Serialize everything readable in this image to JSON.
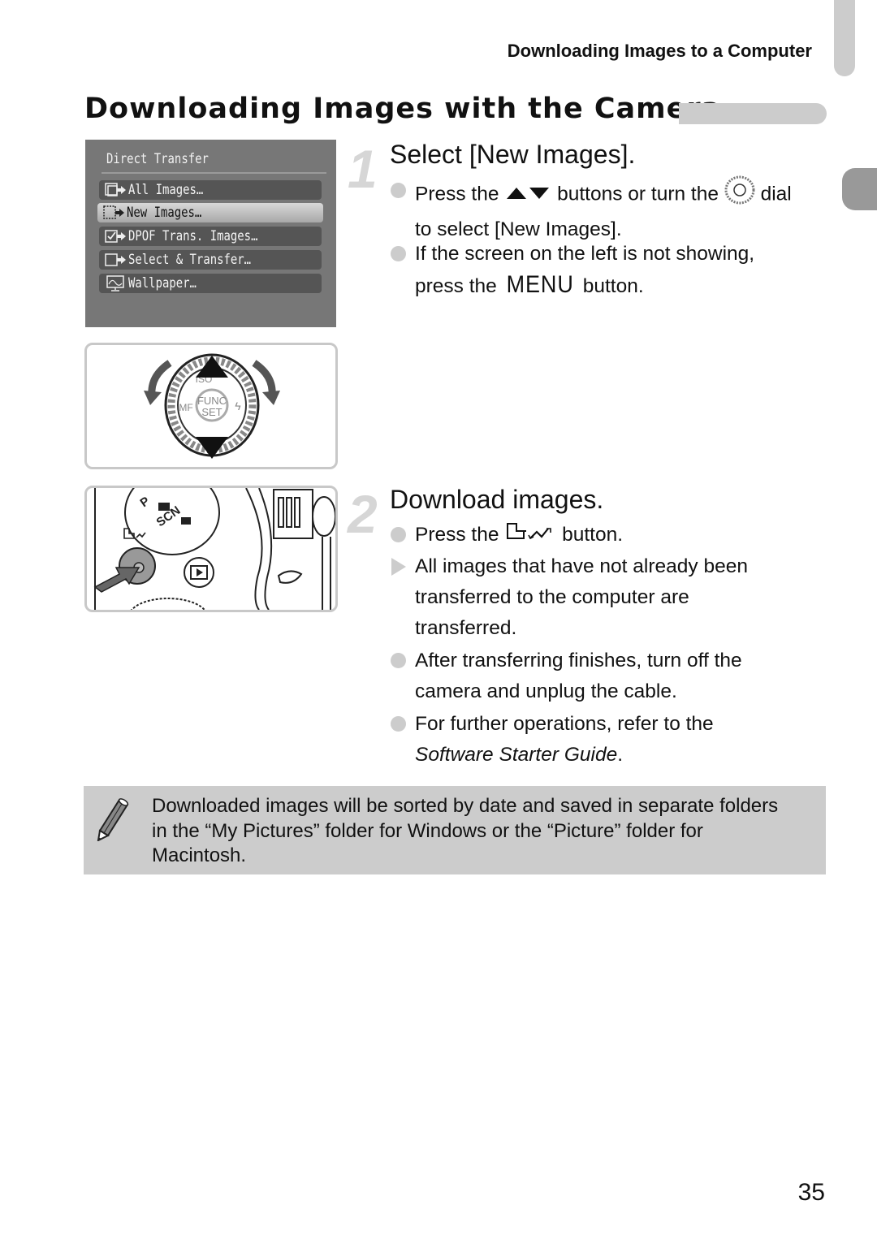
{
  "header": {
    "running_title": "Downloading Images to a Computer"
  },
  "section": {
    "title": "Downloading Images with the Camera"
  },
  "lcd_screen": {
    "title": "Direct Transfer",
    "items": [
      {
        "label": "All Images…",
        "icon": "all-images-transfer-icon",
        "selected": false
      },
      {
        "label": "New Images…",
        "icon": "new-images-transfer-icon",
        "selected": true
      },
      {
        "label": "DPOF Trans. Images…",
        "icon": "dpof-transfer-icon",
        "selected": false
      },
      {
        "label": "Select & Transfer…",
        "icon": "select-transfer-icon",
        "selected": false
      },
      {
        "label": "Wallpaper…",
        "icon": "wallpaper-icon",
        "selected": false
      }
    ]
  },
  "dial_figure": {
    "center_label_top": "FUNC",
    "center_label_bottom": "SET",
    "top_label": "ISO",
    "left_label": "MF"
  },
  "camera_figure": {
    "dial_mode_p": "P",
    "dial_mode_scn": "SCN"
  },
  "steps": [
    {
      "number": "1",
      "heading": "Select [New Images].",
      "bullets": [
        {
          "type": "circle",
          "parts": [
            "Press the ",
            " buttons or turn the ",
            " dial"
          ],
          "line2": "to select [New Images]."
        },
        {
          "type": "circle",
          "text": "If the screen on the left is not showing,",
          "line2_pre": "press the ",
          "line2_glyph": "MENU",
          "line2_post": " button."
        }
      ]
    },
    {
      "number": "2",
      "heading": "Download images.",
      "bullets": [
        {
          "type": "circle",
          "pre": "Press the ",
          "post": " button."
        },
        {
          "type": "triangle",
          "lines": [
            "All images that have not already been",
            "transferred to the computer are",
            "transferred."
          ]
        },
        {
          "type": "circle",
          "lines": [
            "After transferring finishes, turn off the",
            "camera and unplug the cable."
          ]
        },
        {
          "type": "circle",
          "line1": "For further operations, refer to the",
          "italic": "Software Starter Guide",
          "tail": "."
        }
      ]
    }
  ],
  "note": {
    "icon": "pencil-icon",
    "lines": [
      "Downloaded images will be sorted by date and saved in separate folders",
      "in the “My Pictures” folder for Windows or the “Picture” folder for",
      "Macintosh."
    ]
  },
  "footer": {
    "page_number": "35"
  },
  "colors": {
    "tab_light": "#cccccc",
    "tab_dark": "#999999",
    "lcd_bg": "#777777",
    "note_bg": "#cccccc"
  }
}
